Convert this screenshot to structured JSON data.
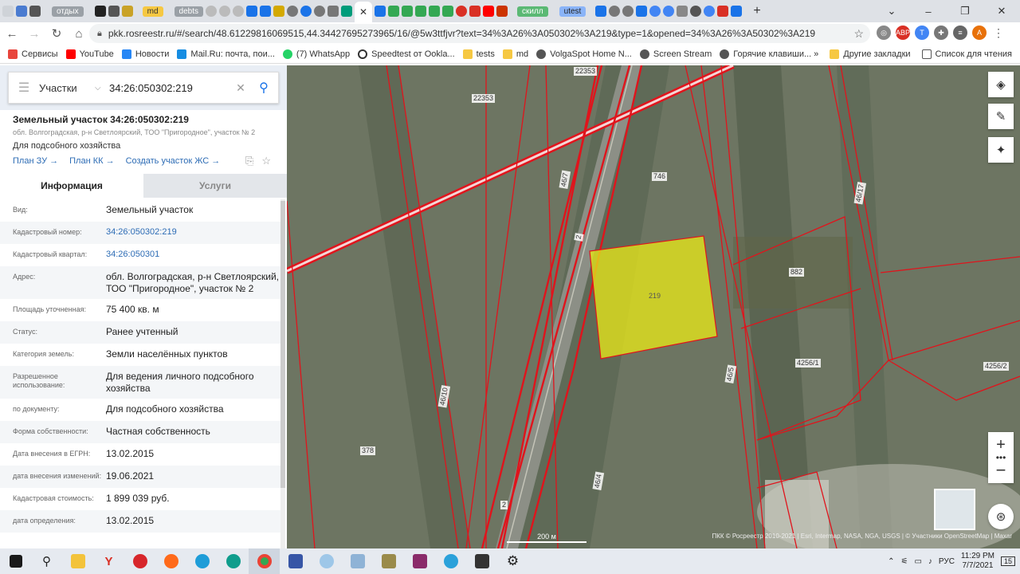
{
  "tabs": [
    {
      "type": "label",
      "text": "отдых",
      "color": "#9aa0a6"
    },
    {
      "type": "label",
      "text": "md",
      "color": "#f6c842"
    },
    {
      "type": "label",
      "text": "debts",
      "color": "#9aa0a6"
    },
    {
      "type": "label",
      "text": "скилл",
      "color": "#5bb974"
    },
    {
      "type": "label",
      "text": "utest",
      "color": "#8ab4f8"
    }
  ],
  "window_controls": {
    "minimize": "–",
    "restore": "❐",
    "close": "✕",
    "new_tab": "+"
  },
  "toolbar": {
    "url": "pkk.rosreestr.ru/#/search/48.61229816069515,44.34427695273965/16/@5w3ttfjvr?text=34%3A26%3A050302%3A219&type=1&opened=34%3A26%3A50302%3A219",
    "back": "←",
    "forward": "→",
    "reload": "↻",
    "home": "⌂",
    "profile": "A"
  },
  "bookmarks": {
    "items": [
      {
        "label": "Сервисы",
        "color": "#e8453c"
      },
      {
        "label": "YouTube",
        "color": "#ff0000"
      },
      {
        "label": "Новости",
        "color": "#2787f5"
      },
      {
        "label": "Mail.Ru: почта, пои...",
        "color": "#168de2"
      },
      {
        "label": "(7) WhatsApp",
        "color": "#25d366"
      },
      {
        "label": "Speedtest от Ookla...",
        "color": "#333333"
      },
      {
        "label": "tests",
        "color": "#f6c842"
      },
      {
        "label": "md",
        "color": "#f6c842"
      },
      {
        "label": "VolgaSpot Home N...",
        "color": "#555555"
      },
      {
        "label": "Screen Stream",
        "color": "#555555"
      },
      {
        "label": "Горячие клавиши...",
        "color": "#555555"
      }
    ],
    "more": "»",
    "other": "Другие закладки",
    "reading": "Список для чтения"
  },
  "search": {
    "category": "Участки",
    "query": "34:26:050302:219"
  },
  "parcel": {
    "title": "Земельный участок 34:26:050302:219",
    "address": "обл. Волгоградская, р-н Светлоярский, ТОО \"Пригородное\", участок № 2",
    "purpose": "Для подсобного хозяйства",
    "links": [
      "План ЗУ →",
      "План КК →",
      "Создать участок ЖС →"
    ]
  },
  "panel_tabs": {
    "info": "Информация",
    "services": "Услуги"
  },
  "info_rows": [
    {
      "k": "Вид:",
      "v": "Земельный участок",
      "link": false
    },
    {
      "k": "Кадастровый номер:",
      "v": "34:26:050302:219",
      "link": true
    },
    {
      "k": "Кадастровый квартал:",
      "v": "34:26:050301",
      "link": true
    },
    {
      "k": "Адрес:",
      "v": "обл. Волгоградская, р-н Светлоярский, ТОО \"Пригородное\", участок № 2",
      "link": false
    },
    {
      "k": "Площадь уточненная:",
      "v": "75 400 кв. м",
      "link": false
    },
    {
      "k": "Статус:",
      "v": "Ранее учтенный",
      "link": false
    },
    {
      "k": "Категория земель:",
      "v": "Земли населённых пунктов",
      "link": false
    },
    {
      "k": "Разрешенное использование:",
      "v": "Для ведения личного подсобного хозяйства",
      "link": false
    },
    {
      "k": "по документу:",
      "v": "Для подсобного хозяйства",
      "link": false
    },
    {
      "k": "Форма собственности:",
      "v": "Частная собственность",
      "link": false
    },
    {
      "k": "Дата внесения в ЕГРН:",
      "v": "13.02.2015",
      "link": false
    },
    {
      "k": "дата внесения изменений:",
      "v": "19.06.2021",
      "link": false
    },
    {
      "k": "Кадастровая стоимость:",
      "v": "1 899 039 руб.",
      "link": false
    },
    {
      "k": "дата определения:",
      "v": "13.02.2015",
      "link": false
    }
  ],
  "map": {
    "labels": [
      "22353",
      "22353",
      "746",
      "46/7",
      "2",
      "219",
      "882",
      "46/17",
      "4256/1",
      "4256/2",
      "46/5",
      "46/10",
      "378",
      "46/4",
      "2"
    ],
    "scale": "200 м",
    "attribution": "ПКК © Росреестр 2010-2021 | Esri, Intermap, NASA, NGA, USGS | © Участники OpenStreetMap | Maxar",
    "colors": {
      "boundary": "#e0141c",
      "selected": "#e6e619",
      "ground": "#6f7764"
    }
  },
  "taskbar": {
    "lang": "РУС",
    "time": "11:29 PM",
    "date": "7/7/2021",
    "notifications": "15"
  }
}
